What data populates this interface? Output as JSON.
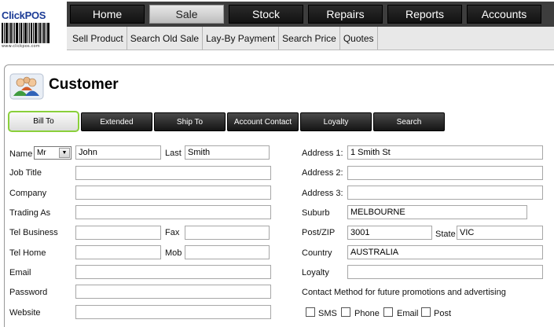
{
  "logo": {
    "brand_click": "Click",
    "brand_pos": "POS",
    "url": "www.clickpos.com"
  },
  "nav": {
    "main": [
      "Home",
      "Sale",
      "Stock",
      "Repairs",
      "Reports",
      "Accounts"
    ],
    "active": "Sale",
    "sub": [
      "Sell Product",
      "Search Old Sale",
      "Lay-By Payment",
      "Search Price",
      "Quotes"
    ]
  },
  "page": {
    "title": "Customer"
  },
  "tabs": [
    "Bill To",
    "Extended",
    "Ship To",
    "Account Contact",
    "Loyalty",
    "Search"
  ],
  "form": {
    "name_label": "Name",
    "salutation": "Mr",
    "first_name": "John",
    "last_label": "Last",
    "last_name": "Smith",
    "job_title_label": "Job Title",
    "company_label": "Company",
    "trading_as_label": "Trading As",
    "tel_business_label": "Tel Business",
    "fax_label": "Fax",
    "tel_home_label": "Tel Home",
    "mob_label": "Mob",
    "email_label": "Email",
    "password_label": "Password",
    "website_label": "Website",
    "address1_label": "Address 1:",
    "address1": "1 Smith St",
    "address2_label": "Address 2:",
    "address3_label": "Address 3:",
    "suburb_label": "Suburb",
    "suburb": "MELBOURNE",
    "postzip_label": "Post/ZIP",
    "postzip": "3001",
    "state_label": "State",
    "state": "VIC",
    "country_label": "Country",
    "country": "AUSTRALIA",
    "loyalty_label": "Loyalty",
    "contact_method_label": "Contact Method for future promotions and advertising",
    "contact_methods": [
      "SMS",
      "Phone",
      "Email",
      "Post"
    ]
  }
}
